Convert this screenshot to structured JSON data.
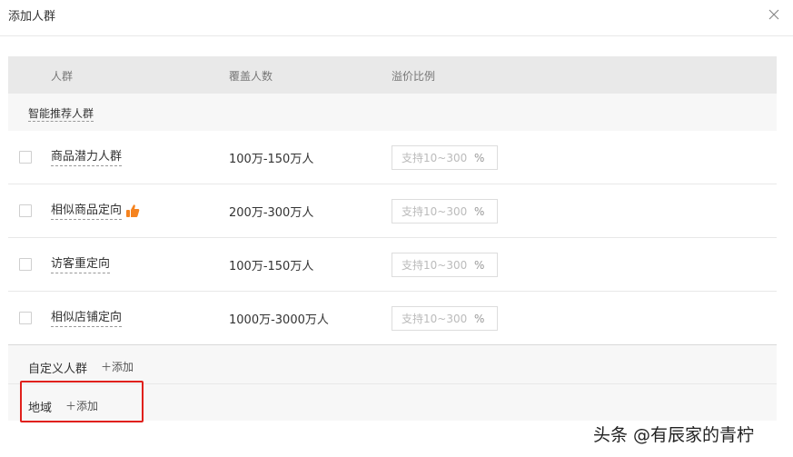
{
  "dialog": {
    "title": "添加人群",
    "close_icon": "close-icon"
  },
  "table": {
    "headers": [
      "人群",
      "覆盖人数",
      "溢价比例"
    ],
    "group_label": "智能推荐人群",
    "rows": [
      {
        "name": "商品潜力人群",
        "coverage": "100万-150万人",
        "premium_placeholder": "支持10~300",
        "unit": "%",
        "recommended": false
      },
      {
        "name": "相似商品定向",
        "coverage": "200万-300万人",
        "premium_placeholder": "支持10~300",
        "unit": "%",
        "recommended": true
      },
      {
        "name": "访客重定向",
        "coverage": "100万-150万人",
        "premium_placeholder": "支持10~300",
        "unit": "%",
        "recommended": false
      },
      {
        "name": "相似店铺定向",
        "coverage": "1000万-3000万人",
        "premium_placeholder": "支持10~300",
        "unit": "%",
        "recommended": false
      }
    ]
  },
  "custom": {
    "label": "自定义人群",
    "add_label": "＋添加"
  },
  "region": {
    "label": "地域",
    "add_label": "＋添加"
  },
  "colors": {
    "highlight": "#e0201c",
    "thumb": "#f5831f",
    "header_bg": "#e9e9e9"
  },
  "watermark": "头条 @有辰家的青柠"
}
